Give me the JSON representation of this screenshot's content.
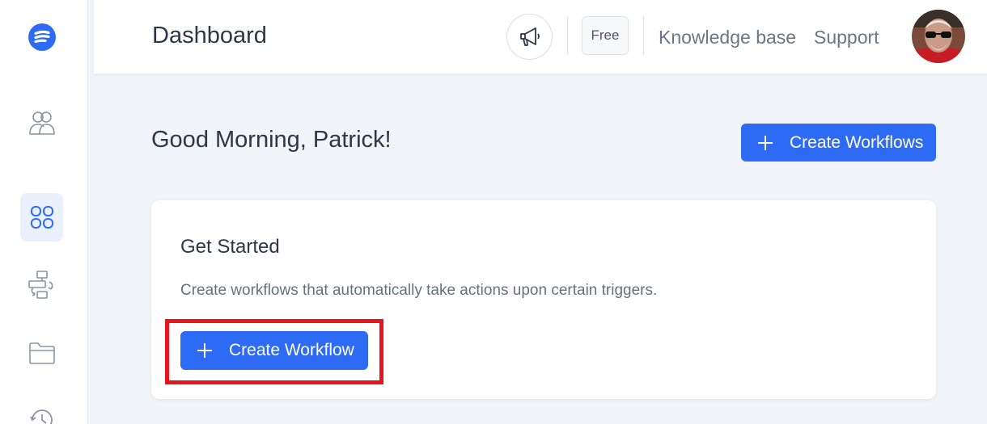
{
  "header": {
    "title": "Dashboard",
    "plan_badge": "Free",
    "links": [
      "Knowledge base",
      "Support"
    ]
  },
  "sidebar": {
    "items": [
      {
        "icon": "logo-icon"
      },
      {
        "icon": "users-icon"
      },
      {
        "icon": "grid-icon",
        "active": true
      },
      {
        "icon": "workflow-icon"
      },
      {
        "icon": "folder-icon"
      },
      {
        "icon": "history-icon"
      }
    ]
  },
  "main": {
    "greeting": "Good Morning, Patrick!",
    "create_workflows_label": "Create Workflows",
    "card": {
      "title": "Get Started",
      "description": "Create workflows that automatically take actions upon certain triggers.",
      "button_label": "Create Workflow"
    }
  },
  "colors": {
    "accent": "#2e6bf5",
    "highlight": "#e8141e"
  }
}
